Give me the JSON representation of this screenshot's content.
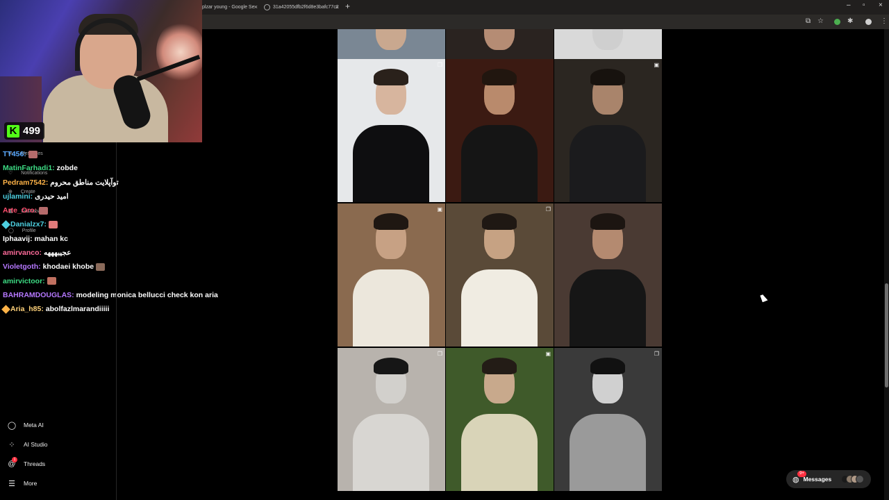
{
  "browser": {
    "tabs": [
      {
        "label": "plzar young - Google Se",
        "close": "×"
      },
      {
        "label": "31a42055dfb2f6d8e3bafc77c2",
        "close": "×"
      }
    ],
    "new_tab": "+",
    "window_controls": [
      "–",
      "▫",
      "×"
    ]
  },
  "stream": {
    "viewer_count": "499",
    "platform_logo": "K",
    "accent": "#53fc18"
  },
  "chat": [
    {
      "user": "TT456:",
      "text": "",
      "color": "#5aa9ff",
      "emote": true,
      "emote_color": "#b56b6b"
    },
    {
      "user": "MatinFarhadi1:",
      "text": "zobde",
      "color": "#3ddc84"
    },
    {
      "user": "Pedram7542:",
      "text": "توآپلایت مناطق محروم",
      "color": "#ffb347"
    },
    {
      "user": "ujlamini:",
      "text": "امید حیدری",
      "color": "#4dd0e1"
    },
    {
      "user": "Arte_Oro:",
      "text": "",
      "color": "#ff4d6d",
      "emote": true,
      "emote_color": "#b56b6b"
    },
    {
      "user": "Danialzx7:",
      "text": "",
      "color": "#4dd0e1",
      "badge": true,
      "emote": true,
      "emote_color": "#e07a7a"
    },
    {
      "user": "Iphaavij:",
      "text": "mahan kc",
      "color": "#ffffff"
    },
    {
      "user": "amirvanco:",
      "text": "عجیبهههه",
      "color": "#ff6b9a"
    },
    {
      "user": "Violetgoth:",
      "text": "khodaei khobe",
      "color": "#b678ff",
      "emote": true,
      "emote_color": "#8a6a5a"
    },
    {
      "user": "amirvictoor:",
      "text": "",
      "color": "#3ddc84",
      "emote": true,
      "emote_color": "#c07060"
    },
    {
      "user": "BAHRAMDOUGLAS:",
      "text": "modeling monica bellucci check kon aria",
      "color": "#b678ff"
    },
    {
      "user": "Aria_h85:",
      "text": "abolfazlmarandiiiii",
      "color": "#ffd27a",
      "badge": true
    }
  ],
  "ghost_sidebar": [
    "Messages",
    "Notifications",
    "Create",
    "Dashboard",
    "Profile"
  ],
  "sidebar": [
    {
      "label": "Meta AI",
      "icon": "meta-ai-icon",
      "glyph": "◯"
    },
    {
      "label": "AI Studio",
      "icon": "ai-studio-icon",
      "glyph": "⁘"
    },
    {
      "label": "Threads",
      "icon": "threads-icon",
      "glyph": "@",
      "badge": "1"
    },
    {
      "label": "More",
      "icon": "menu-icon",
      "glyph": "☰"
    }
  ],
  "messages_button": {
    "label": "Messages",
    "badge": "9+"
  },
  "grid_posts": [
    {
      "type": "carousel",
      "bg": "#7a8794",
      "skin": "#c9a88f",
      "hair": "#2a211d",
      "shirt": "#8aa1c0"
    },
    {
      "type": "none",
      "bg": "#2a2320",
      "skin": "#b58c74",
      "hair": "#1e1815",
      "shirt": "#3a3a3a"
    },
    {
      "type": "none",
      "bg": "#d9d9d9",
      "skin": "#cfcfcf",
      "hair": "#1a1a1a",
      "shirt": "#eeeeee"
    },
    {
      "type": "carousel",
      "bg": "#e6e8ea",
      "skin": "#d7b59e",
      "hair": "#2a211b",
      "shirt": "#0e0e10"
    },
    {
      "type": "none",
      "bg": "#3b1a12",
      "skin": "#b98a6c",
      "hair": "#21160f",
      "shirt": "#151515"
    },
    {
      "type": "reel",
      "bg": "#2b2621",
      "skin": "#a9846b",
      "hair": "#17120e",
      "shirt": "#1b1b1d"
    },
    {
      "type": "reel",
      "bg": "#8a6a4f",
      "skin": "#c7a184",
      "hair": "#1f1712",
      "shirt": "#ece7dc"
    },
    {
      "type": "carousel",
      "bg": "#5a4a38",
      "skin": "#c6a283",
      "hair": "#1f1813",
      "shirt": "#f0ece2"
    },
    {
      "type": "none",
      "bg": "#4a3a33",
      "skin": "#b48a70",
      "hair": "#1c1511",
      "shirt": "#161616"
    },
    {
      "type": "carousel",
      "bg": "#b8b3ad",
      "skin": "#d2d0cc",
      "hair": "#161616",
      "shirt": "#d8d6d2"
    },
    {
      "type": "reel",
      "bg": "#3f5a2a",
      "skin": "#c8a98c",
      "hair": "#231c16",
      "shirt": "#d9d4b8"
    },
    {
      "type": "carousel",
      "bg": "#3a3a3a",
      "skin": "#d0d0d0",
      "hair": "#111111",
      "shirt": "#9a9a9a"
    }
  ]
}
